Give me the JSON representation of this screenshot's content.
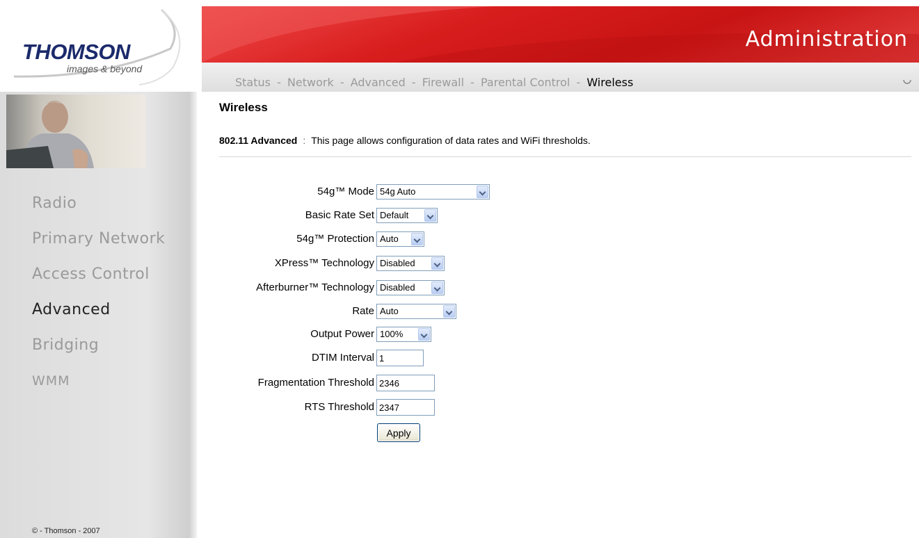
{
  "brand": {
    "logo": "THOMSON",
    "tagline": "images & beyond",
    "copyright": "© - Thomson - 2007"
  },
  "header": {
    "title": "Administration"
  },
  "topnav": {
    "items": [
      {
        "label": "Status",
        "sep": " - "
      },
      {
        "label": "Network",
        "sep": " - "
      },
      {
        "label": "Advanced",
        "sep": " - "
      },
      {
        "label": "Firewall",
        "sep": " - "
      },
      {
        "label": "Parental Control",
        "sep": " - "
      },
      {
        "label": "Wireless",
        "sep": ""
      }
    ],
    "current": "Wireless"
  },
  "sidebar": {
    "items": [
      {
        "label": "Radio"
      },
      {
        "label": "Primary Network"
      },
      {
        "label": "Access Control"
      },
      {
        "label": "Advanced"
      },
      {
        "label": "Bridging"
      },
      {
        "label": "WMM"
      }
    ],
    "active": "Advanced"
  },
  "main": {
    "title": "Wireless",
    "desc_heading": "802.11 Advanced",
    "desc_sep": ":",
    "desc_text": "This page allows configuration of data rates and WiFi thresholds."
  },
  "form": {
    "mode_54g": {
      "label": "54g™ Mode",
      "value": "54g Auto"
    },
    "basic_rate_set": {
      "label": "Basic Rate Set",
      "value": "Default"
    },
    "protection_54g": {
      "label": "54g™ Protection",
      "value": "Auto"
    },
    "xpress": {
      "label": "XPress™ Technology",
      "value": "Disabled"
    },
    "afterburner": {
      "label": "Afterburner™ Technology",
      "value": "Disabled"
    },
    "rate": {
      "label": "Rate",
      "value": "Auto"
    },
    "output_power": {
      "label": "Output Power",
      "value": "100%"
    },
    "dtim": {
      "label": "DTIM Interval",
      "value": "1"
    },
    "frag": {
      "label": "Fragmentation Threshold",
      "value": "2346"
    },
    "rts": {
      "label": "RTS Threshold",
      "value": "2347"
    },
    "apply_label": "Apply"
  },
  "colors": {
    "banner": "#d81d1d",
    "logo": "#1b2a6b",
    "nav_inactive": "#9a9a9a"
  }
}
